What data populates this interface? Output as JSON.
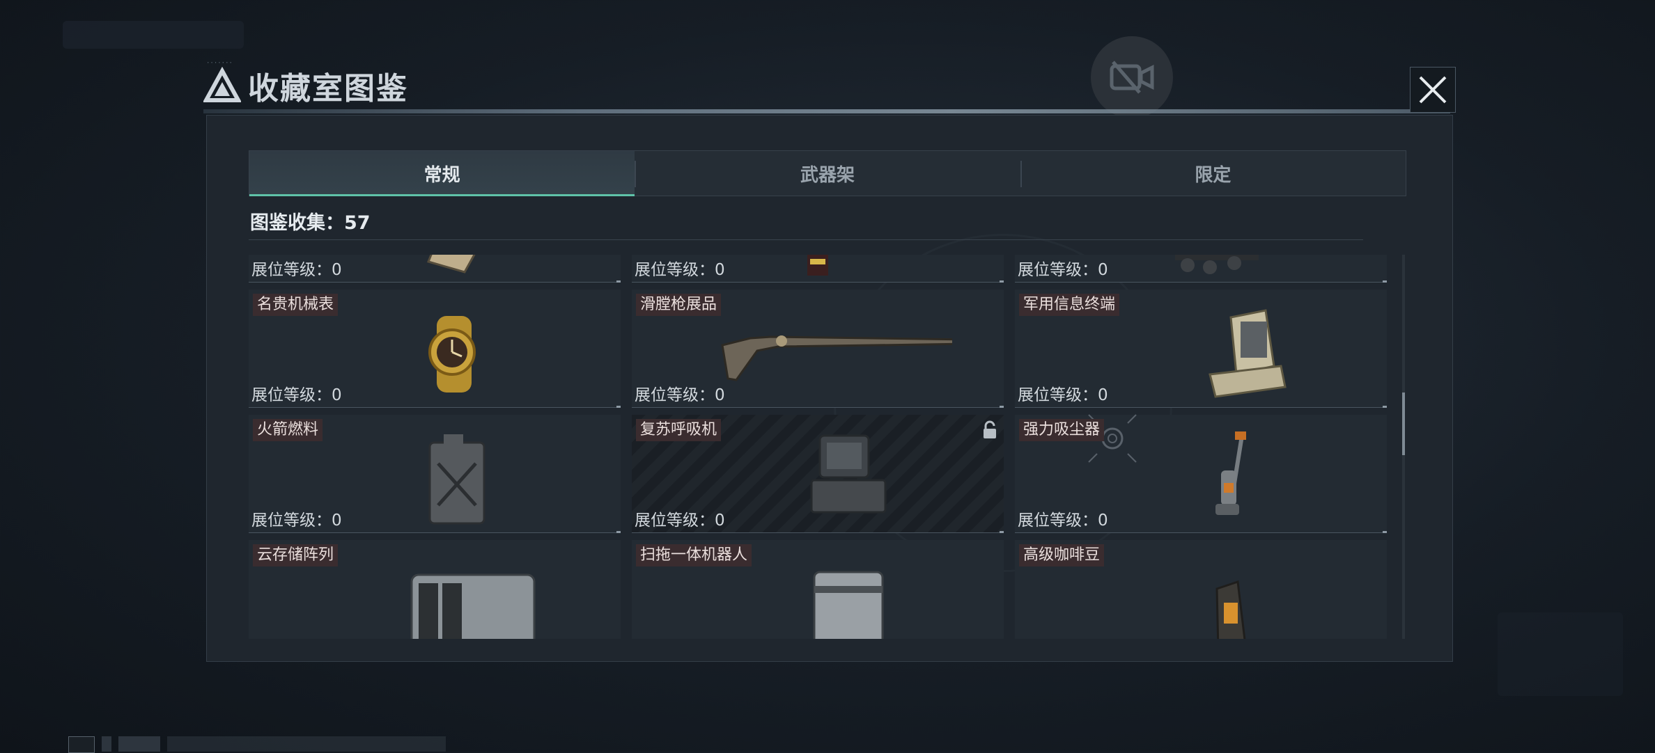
{
  "header": {
    "title": "收藏室图鉴"
  },
  "tabs": [
    {
      "label": "常规",
      "active": true
    },
    {
      "label": "武器架",
      "active": false
    },
    {
      "label": "限定",
      "active": false
    }
  ],
  "collection": {
    "label": "图鉴收集：57"
  },
  "level_label": "展位等级：0",
  "items": [
    {
      "name": "",
      "level": "展位等级：0",
      "icon": "frame-art-icon"
    },
    {
      "name": "",
      "level": "展位等级：0",
      "icon": "explosive-icon"
    },
    {
      "name": "",
      "level": "展位等级：0",
      "icon": "cart-icon"
    },
    {
      "name": "名贵机械表",
      "level": "展位等级：0",
      "icon": "watch-icon"
    },
    {
      "name": "滑膛枪展品",
      "level": "展位等级：0",
      "icon": "musket-icon"
    },
    {
      "name": "军用信息终端",
      "level": "展位等级：0",
      "icon": "terminal-case-icon"
    },
    {
      "name": "火箭燃料",
      "level": "展位等级：0",
      "icon": "fuel-can-icon"
    },
    {
      "name": "复苏呼吸机",
      "level": "展位等级：0",
      "icon": "ventilator-icon",
      "locked": true
    },
    {
      "name": "强力吸尘器",
      "level": "展位等级：0",
      "icon": "vacuum-icon"
    },
    {
      "name": "云存储阵列",
      "level": "",
      "icon": "storage-array-icon"
    },
    {
      "name": "扫拖一体机器人",
      "level": "",
      "icon": "robot-mop-icon"
    },
    {
      "name": "高级咖啡豆",
      "level": "",
      "icon": "coffee-bag-icon"
    }
  ],
  "colors": {
    "accent": "#5fc3a9",
    "tag_bg": "#3a2c2f",
    "panel_bg": "#1f262e"
  }
}
